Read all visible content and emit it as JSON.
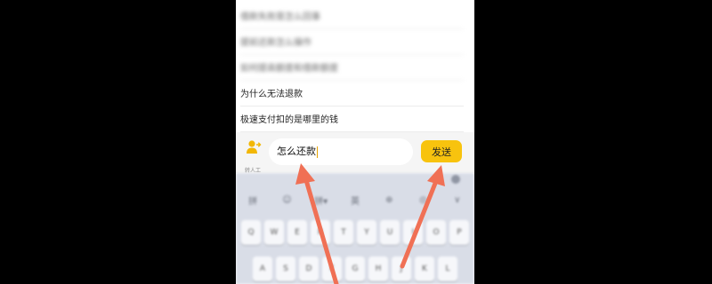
{
  "faq": {
    "items": [
      {
        "label": "借款失败是怎么回事",
        "blurred": true
      },
      {
        "label": "提前还款怎么操作",
        "blurred": true
      },
      {
        "label": "如何提高额度和借款额度",
        "blurred": true
      },
      {
        "label": "为什么无法退款",
        "blurred": false
      },
      {
        "label": "极速支付扣的是哪里的钱",
        "blurred": false
      }
    ]
  },
  "input_bar": {
    "agent_label": "转人工",
    "message_value": "怎么还款",
    "send_label": "发送"
  },
  "keyboard": {
    "toolbar": [
      "拼",
      "☺",
      "拼▾",
      "英",
      "⊕",
      "◎",
      "∨"
    ],
    "row1": [
      "Q",
      "W",
      "E",
      "R",
      "T",
      "Y",
      "U",
      "I",
      "O",
      "P"
    ],
    "row2": [
      "A",
      "S",
      "D",
      "F",
      "G",
      "H",
      "J",
      "K",
      "L"
    ]
  },
  "colors": {
    "accent": "#f8c30e",
    "arrow": "#f07055"
  }
}
